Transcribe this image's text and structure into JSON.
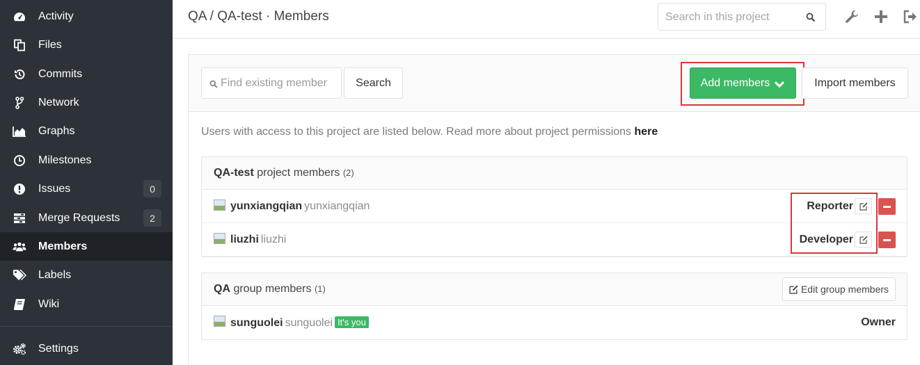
{
  "sidebar": {
    "items": [
      {
        "label": "Activity",
        "icon": "dashboard-icon"
      },
      {
        "label": "Files",
        "icon": "files-icon"
      },
      {
        "label": "Commits",
        "icon": "history-icon"
      },
      {
        "label": "Network",
        "icon": "code-fork-icon"
      },
      {
        "label": "Graphs",
        "icon": "area-chart-icon"
      },
      {
        "label": "Milestones",
        "icon": "clock-icon"
      },
      {
        "label": "Issues",
        "icon": "exclamation-circle-icon",
        "count": "0"
      },
      {
        "label": "Merge Requests",
        "icon": "tasks-icon",
        "count": "2"
      },
      {
        "label": "Members",
        "icon": "users-icon",
        "active": true
      },
      {
        "label": "Labels",
        "icon": "tags-icon"
      },
      {
        "label": "Wiki",
        "icon": "book-icon"
      },
      {
        "label": "Settings",
        "icon": "cogs-icon"
      }
    ]
  },
  "header": {
    "title": "QA / QA-test · Members",
    "search_placeholder": "Search in this project",
    "icons": [
      "wrench-icon",
      "plus-icon",
      "sign-out-icon"
    ]
  },
  "toolbar": {
    "find_placeholder": "Find existing member",
    "search_label": "Search",
    "add_members_label": "Add members",
    "import_members_label": "Import members"
  },
  "intro": {
    "text": "Users with access to this project are listed below. Read more about project permissions ",
    "link": "here"
  },
  "project_members": {
    "name": "QA-test",
    "suffix": " project members",
    "count": "(2)",
    "rows": [
      {
        "name": "yunxiangqian",
        "handle": "yunxiangqian",
        "role": "Reporter"
      },
      {
        "name": "liuzhi",
        "handle": "liuzhi",
        "role": "Developer"
      }
    ]
  },
  "group_members": {
    "name": "QA",
    "suffix": " group members",
    "count": "(1)",
    "edit_label": "Edit group members",
    "rows": [
      {
        "name": "sunguolei",
        "handle": "sunguolei",
        "badge": "It's you",
        "role": "Owner"
      }
    ]
  },
  "colors": {
    "sidebar_bg": "#2d3238",
    "active_bg": "#1f2328",
    "accent_green": "#3cb965",
    "danger_red": "#d9534f",
    "highlight_red": "#d9363e"
  }
}
